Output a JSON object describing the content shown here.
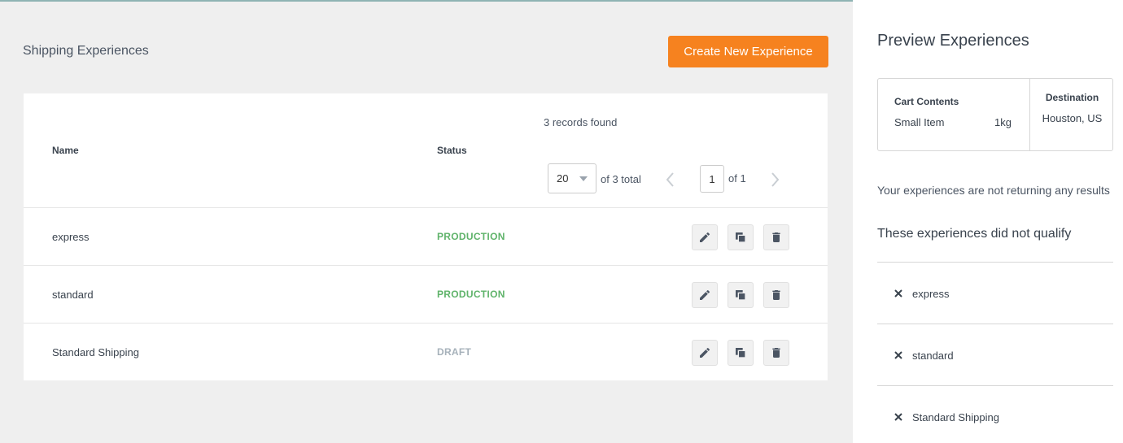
{
  "header": {
    "page_title": "Shipping Experiences",
    "create_button_label": "Create New Experience"
  },
  "table": {
    "records_found": "3 records found",
    "columns": {
      "name": "Name",
      "status": "Status"
    },
    "pagination": {
      "per_page": "20",
      "of_total": "of 3 total",
      "current_page": "1",
      "of_pages": "of 1"
    },
    "rows": [
      {
        "name": "express",
        "status": "PRODUCTION"
      },
      {
        "name": "standard",
        "status": "PRODUCTION"
      },
      {
        "name": "Standard Shipping",
        "status": "DRAFT"
      }
    ]
  },
  "preview": {
    "title": "Preview Experiences",
    "cart_contents_label": "Cart Contents",
    "cart_item": "Small Item",
    "cart_weight": "1kg",
    "destination_label": "Destination",
    "destination_value": "Houston, US",
    "no_results_message": "Your experiences are not returning any results",
    "not_qualify_heading": "These experiences did not qualify",
    "not_qualified": [
      "express",
      "standard",
      "Standard Shipping"
    ]
  },
  "colors": {
    "accent": "#f6821f",
    "production": "#5fb36a",
    "draft": "#a6b1ba"
  },
  "icons": {
    "edit": "pencil-icon",
    "copy": "copy-icon",
    "delete": "trash-icon",
    "not_qualified": "close-icon"
  }
}
